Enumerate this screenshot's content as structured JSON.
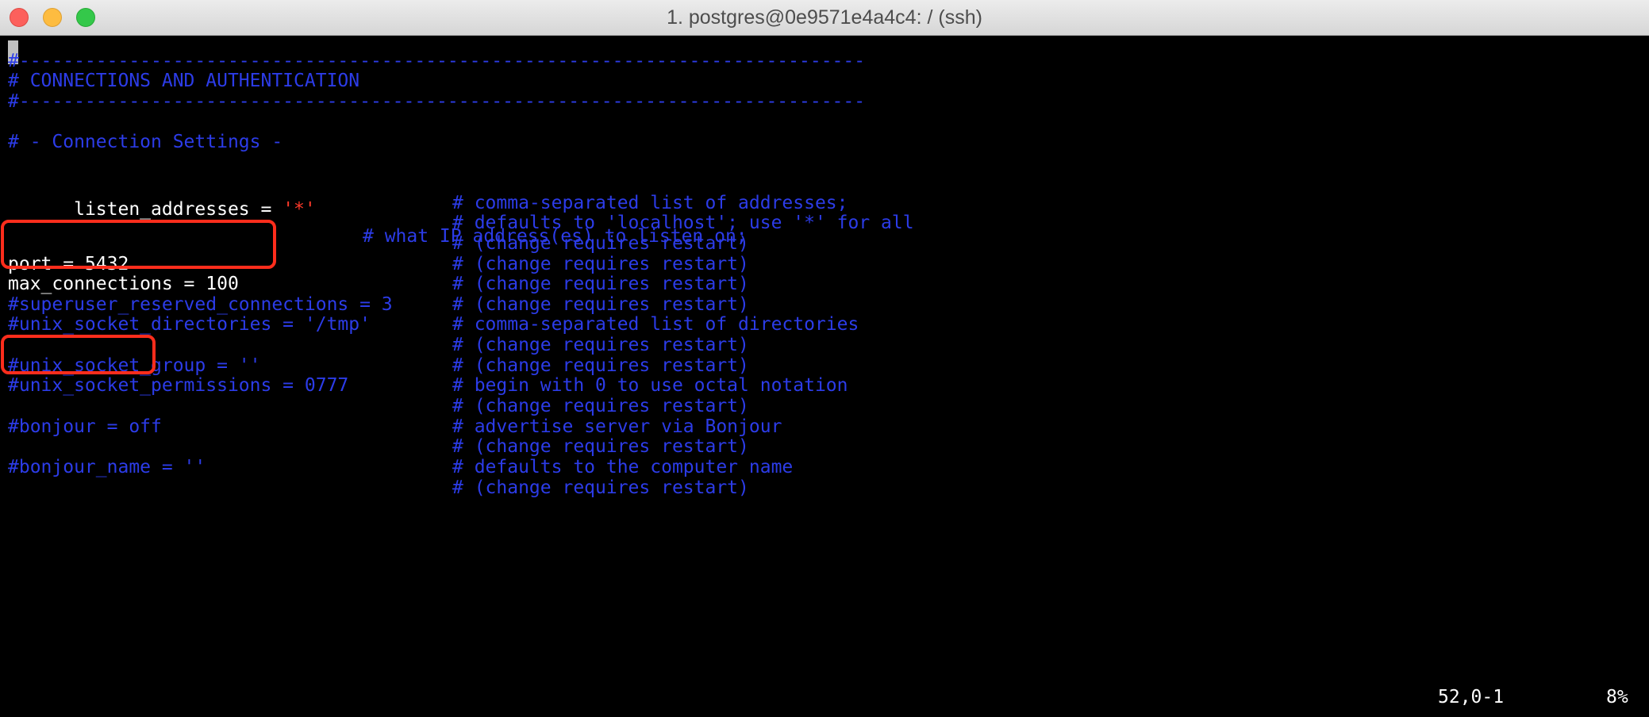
{
  "window": {
    "title": "1. postgres@0e9571e4a4c4: / (ssh)"
  },
  "editor": {
    "lines": {
      "rule1": "#-----------------------------------------------------------------------------",
      "heading": "# CONNECTIONS AND AUTHENTICATION",
      "rule2": "#-----------------------------------------------------------------------------",
      "section": "# - Connection Settings -",
      "listen_key": "listen_addresses = ",
      "listen_value": "'*'",
      "listen_comment": "# what IP address(es) to listen on;",
      "listen_comment2": "# comma-separated list of addresses;",
      "listen_comment3": "# defaults to 'localhost'; use '*' for all",
      "listen_comment4": "# (change requires restart)",
      "port_setting": "port = 5432",
      "port_comment": "# (change requires restart)",
      "maxconn_setting": "max_connections = 100",
      "maxconn_comment": "# (change requires restart)",
      "superuser_setting": "#superuser_reserved_connections = 3",
      "superuser_comment": "# (change requires restart)",
      "unixdir_setting": "#unix_socket_directories = '/tmp'",
      "unixdir_comment": "# comma-separated list of directories",
      "unixdir_comment2": "# (change requires restart)",
      "unixgroup_setting": "#unix_socket_group = ''",
      "unixgroup_comment": "# (change requires restart)",
      "unixperm_setting": "#unix_socket_permissions = 0777",
      "unixperm_comment": "# begin with 0 to use octal notation",
      "unixperm_comment2": "# (change requires restart)",
      "bonjour_setting": "#bonjour = off",
      "bonjour_comment": "# advertise server via Bonjour",
      "bonjour_comment2": "# (change requires restart)",
      "bonjourname_setting": "#bonjour_name = ''",
      "bonjourname_comment": "# defaults to the computer name",
      "bonjourname_comment2": "# (change requires restart)"
    },
    "status": {
      "position": "52,0-1",
      "percent": "8%"
    }
  },
  "colors": {
    "background": "#000000",
    "comment": "#2c3ce8",
    "text": "#ffffff",
    "string": "#ff3a2a",
    "highlight_box": "#ff2d1c"
  }
}
